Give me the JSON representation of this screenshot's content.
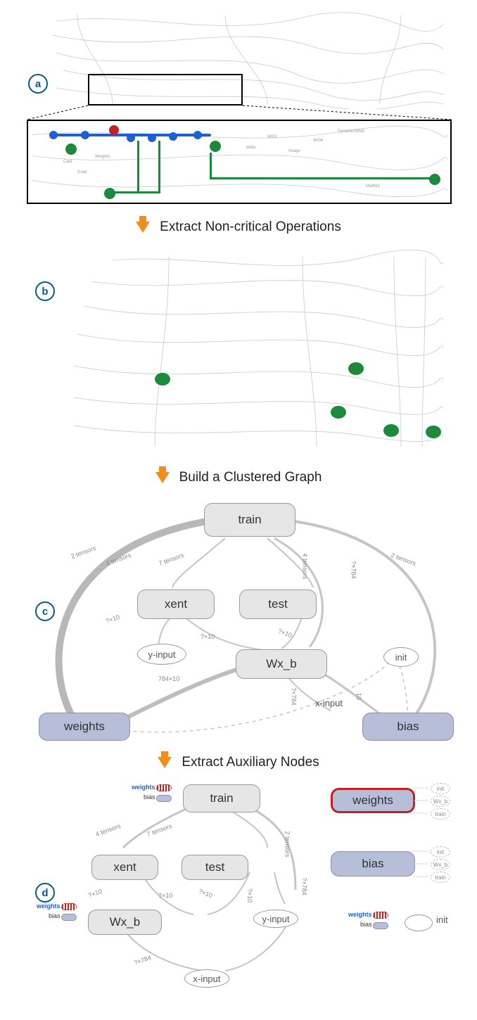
{
  "steps": {
    "extract_noncritical": "Extract Non-critical Operations",
    "build_clustered": "Build a Clustered Graph",
    "extract_auxiliary": "Extract Auxiliary Nodes"
  },
  "panels": {
    "a": "a",
    "b": "b",
    "c": "c",
    "d": "d"
  },
  "zoom_tiny_labels": [
    "Cast",
    "Grad",
    "Weights",
    "delta",
    "W/01",
    "Image",
    "W/04",
    "DynamicStitch",
    "MatMul"
  ],
  "clustered": {
    "nodes": {
      "train": "train",
      "xent": "xent",
      "test": "test",
      "wx_b": "Wx_b",
      "weights": "weights",
      "bias": "bias"
    },
    "ellipses": {
      "y_input": "y-input",
      "x_input": "x-input",
      "init": "init"
    },
    "edge_labels": {
      "two_tensors": "2 tensors",
      "seven_tensors": "7 tensors",
      "four_tensors": "4 tensors",
      "q10": "?×10",
      "q10b": "?×10",
      "q784": "?×784",
      "s784x10": "784×10",
      "s10": "10"
    }
  },
  "aux_panel": {
    "proxy_labels": {
      "weights": "weights",
      "bias": "bias"
    },
    "side_nodes": {
      "weights": "weights",
      "bias": "bias"
    },
    "side_targets": {
      "init": "init",
      "wx_b": "Wx_b",
      "train": "train"
    },
    "init": "init"
  }
}
